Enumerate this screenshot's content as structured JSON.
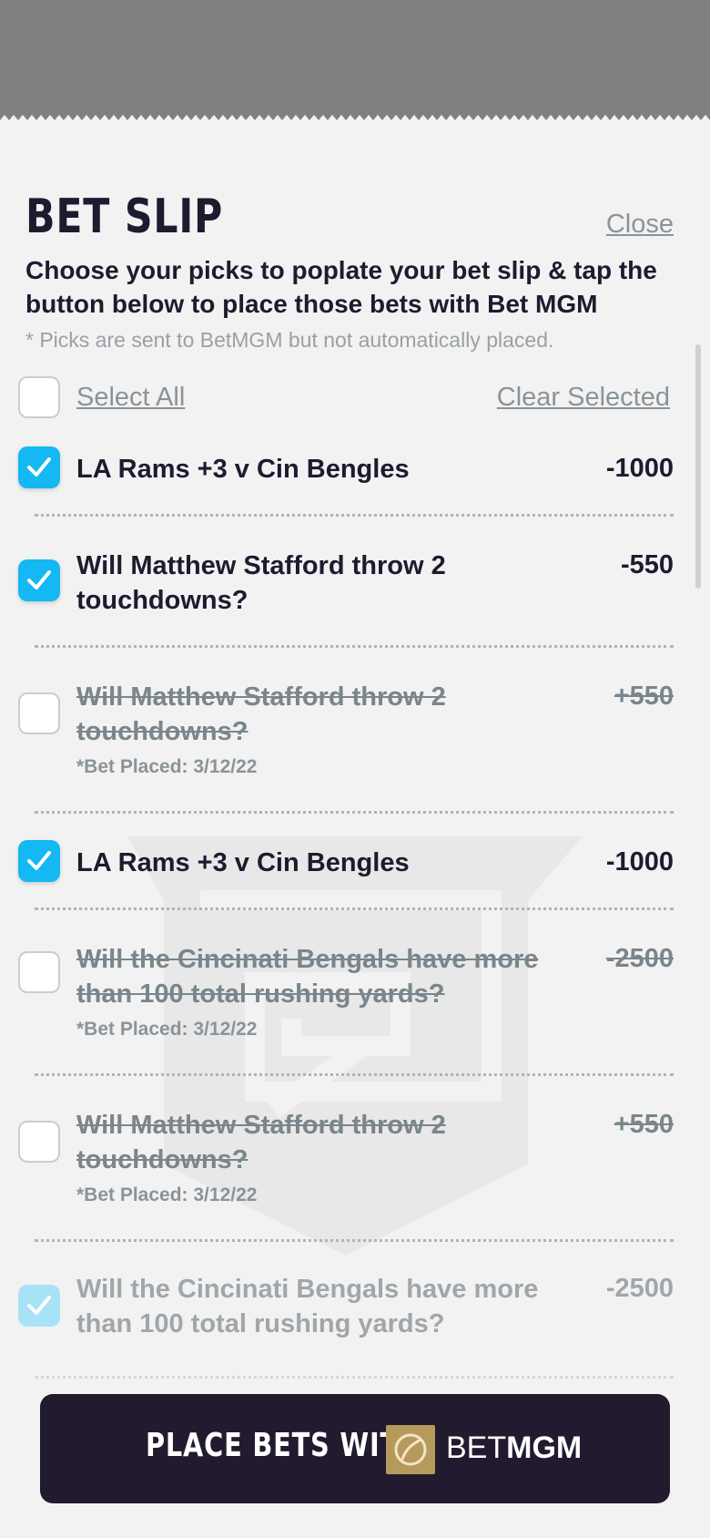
{
  "sheet": {
    "title": "BET SLIP",
    "close_label": "Close",
    "description": "Choose your picks to poplate your bet slip & tap the button below to place those bets with Bet MGM",
    "note": "* Picks are sent to BetMGM but not automatically placed."
  },
  "controls": {
    "select_all": "Select All",
    "clear_selected": "Clear Selected"
  },
  "bets": [
    {
      "label": "LA Rams +3 v Cin Bengles",
      "odds": "-1000",
      "status": "checked"
    },
    {
      "label": "Will Matthew Stafford throw 2 touchdowns?",
      "odds": "-550",
      "status": "checked"
    },
    {
      "label": "Will Matthew Stafford throw 2 touchdowns?",
      "odds": "+550",
      "status": "placed",
      "meta": "*Bet Placed: 3/12/22"
    },
    {
      "label": "LA Rams +3 v Cin Bengles",
      "odds": "-1000",
      "status": "checked"
    },
    {
      "label": "Will the Cincinati Bengals have more than 100 total rushing yards?",
      "odds": "-2500",
      "status": "placed",
      "meta": "*Bet Placed: 3/12/22"
    },
    {
      "label": "Will Matthew Stafford throw 2 touchdowns?",
      "odds": "+550",
      "status": "placed",
      "meta": "*Bet Placed: 3/12/22"
    },
    {
      "label": "Will the Cincinati Bengals have more than 100 total rushing yards?",
      "odds": "-2500",
      "status": "checked"
    }
  ],
  "footer": {
    "button_label": "PLACE BETS WITH",
    "brand_bet": "BET",
    "brand_mgm": "MGM"
  },
  "colors": {
    "accent": "#14b8f2",
    "dark": "#221a2e",
    "gold": "#b69a5c"
  }
}
